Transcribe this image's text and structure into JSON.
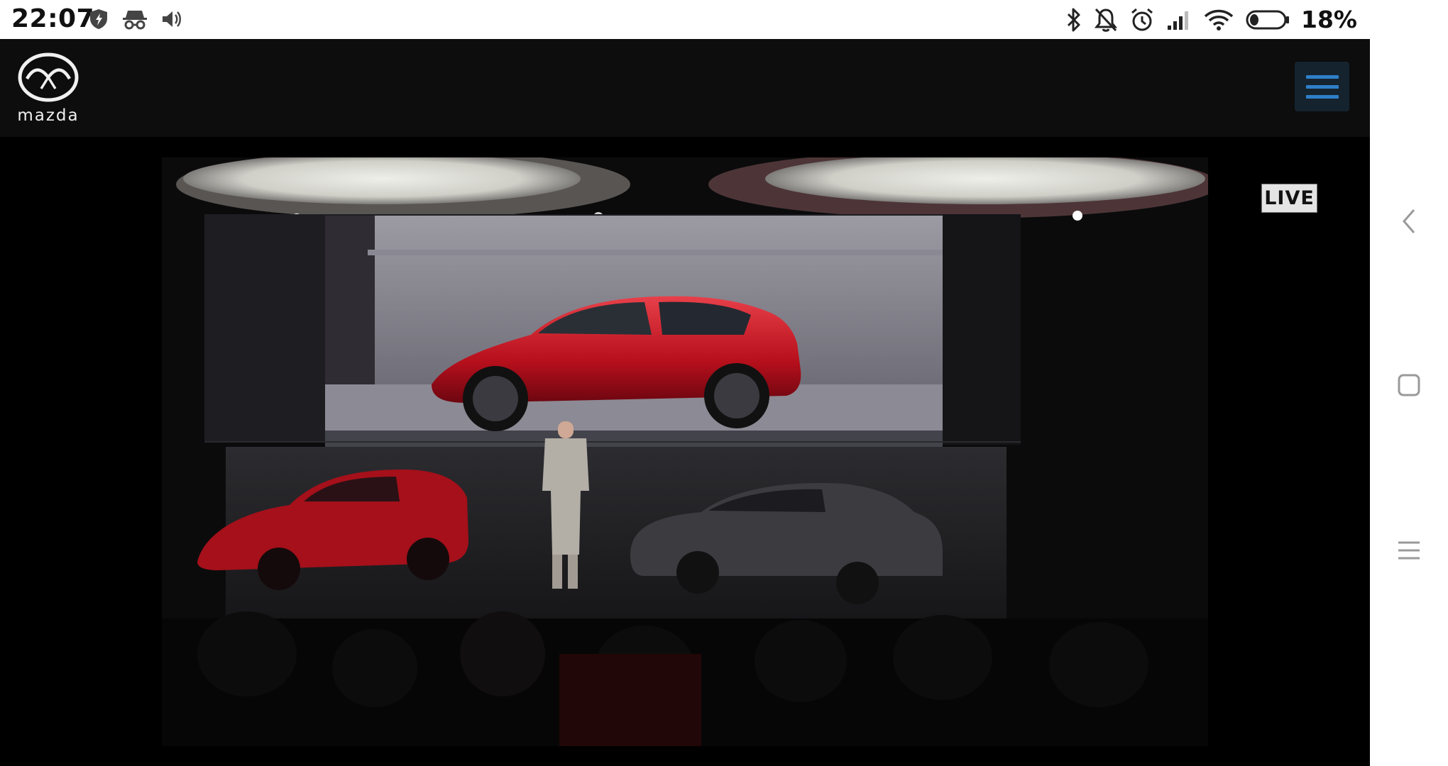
{
  "status_bar": {
    "time": "22:07",
    "battery_percent": "18%",
    "icons_left": [
      "shield-icon",
      "incognito-icon",
      "volume-icon"
    ],
    "icons_right": [
      "bluetooth-icon",
      "notifications-off-icon",
      "alarm-icon",
      "signal-icon",
      "wifi-icon",
      "battery-icon"
    ]
  },
  "header": {
    "logo_text": "mazda",
    "menu_icon": "hamburger-menu-icon",
    "menu_color": "#2f7fc8"
  },
  "video": {
    "live_badge": "LIVE"
  },
  "nav_bar": {
    "buttons": [
      "back-icon",
      "home-icon",
      "recents-icon"
    ]
  }
}
